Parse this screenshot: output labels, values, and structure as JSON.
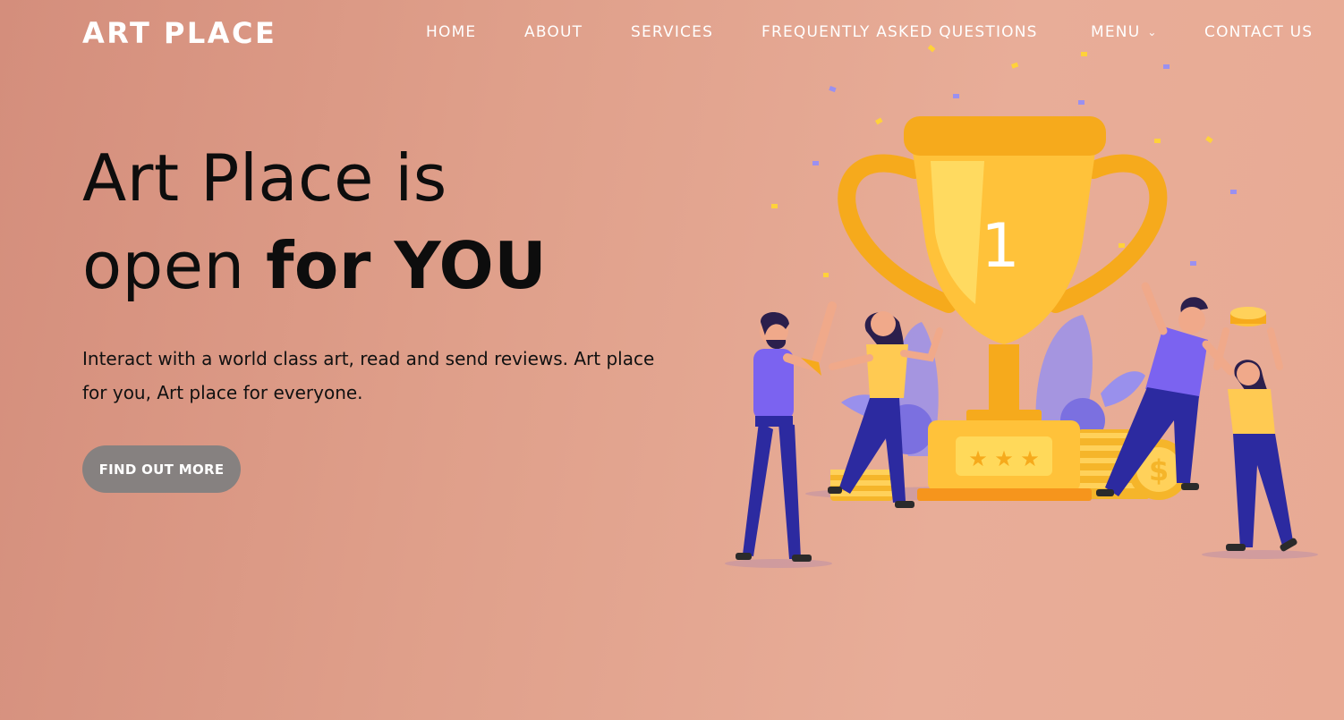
{
  "brand": "ART PLACE",
  "nav": {
    "items": [
      {
        "label": "HOME"
      },
      {
        "label": "ABOUT"
      },
      {
        "label": "SERVICES"
      },
      {
        "label": "FREQUENTLY ASKED QUESTIONS"
      },
      {
        "label": "MENU",
        "has_dropdown": true
      },
      {
        "label": "CONTACT US"
      }
    ]
  },
  "hero": {
    "title_line1": "Art Place is",
    "title_line2_regular": "open ",
    "title_line2_bold": "for YOU",
    "description": "Interact with a world class art, read and send reviews. Art place for you, Art place for everyone.",
    "cta_label": "FIND OUT MORE"
  },
  "illustration": {
    "trophy_number": "1",
    "icon": "trophy-celebration-illustration"
  },
  "colors": {
    "background": "#df9f8a",
    "brand_text": "#ffffff",
    "cta_bg": "#868180",
    "trophy": "#ffc23a",
    "people_shirt": "#7b63f0",
    "pants": "#2c2aa0"
  }
}
